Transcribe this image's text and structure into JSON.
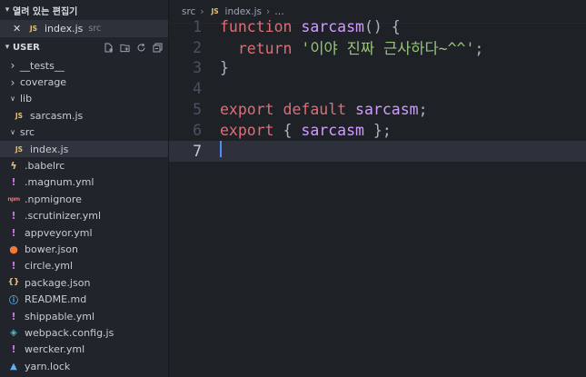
{
  "sidebar": {
    "open_editors_title": "열려 있는 편집기",
    "open_files": [
      {
        "name": "index.js",
        "folder": "src",
        "lang": "JS"
      }
    ],
    "workspace_title": "USER",
    "tree": [
      {
        "label": "__tests__",
        "type": "folder-collapsed",
        "depth": 1
      },
      {
        "label": "coverage",
        "type": "folder-collapsed",
        "depth": 1
      },
      {
        "label": "lib",
        "type": "folder-open",
        "depth": 1
      },
      {
        "label": "sarcasm.js",
        "type": "js",
        "depth": 2
      },
      {
        "label": "src",
        "type": "folder-open",
        "depth": 1
      },
      {
        "label": "index.js",
        "type": "js",
        "depth": 2,
        "selected": true
      },
      {
        "label": ".babelrc",
        "type": "babel",
        "depth": 1
      },
      {
        "label": ".magnum.yml",
        "type": "yml",
        "depth": 1
      },
      {
        "label": ".npmignore",
        "type": "npm",
        "depth": 1
      },
      {
        "label": ".scrutinizer.yml",
        "type": "yml",
        "depth": 1
      },
      {
        "label": "appveyor.yml",
        "type": "yml",
        "depth": 1
      },
      {
        "label": "bower.json",
        "type": "bower",
        "depth": 1
      },
      {
        "label": "circle.yml",
        "type": "yml",
        "depth": 1
      },
      {
        "label": "package.json",
        "type": "json",
        "depth": 1
      },
      {
        "label": "README.md",
        "type": "info",
        "depth": 1
      },
      {
        "label": "shippable.yml",
        "type": "yml",
        "depth": 1
      },
      {
        "label": "webpack.config.js",
        "type": "webpack",
        "depth": 1
      },
      {
        "label": "wercker.yml",
        "type": "yml",
        "depth": 1
      },
      {
        "label": "yarn.lock",
        "type": "yarn",
        "depth": 1
      }
    ]
  },
  "breadcrumb": {
    "folder": "src",
    "file": "index.js",
    "lang": "JS"
  },
  "editor": {
    "current_line": 7,
    "lines": [
      {
        "n": "1",
        "tokens": [
          {
            "t": "function",
            "c": "kw"
          },
          {
            "t": " ",
            "c": "pun"
          },
          {
            "t": "sarcasm",
            "c": "fnname"
          },
          {
            "t": "()",
            "c": "pun"
          },
          {
            "t": " {",
            "c": "pun"
          }
        ]
      },
      {
        "n": "2",
        "tokens": [
          {
            "t": "  return",
            "c": "kw"
          },
          {
            "t": " ",
            "c": "pun"
          },
          {
            "t": "'이야 진짜 근사하다~^^'",
            "c": "str"
          },
          {
            "t": ";",
            "c": "pun"
          }
        ]
      },
      {
        "n": "3",
        "tokens": [
          {
            "t": "}",
            "c": "pun"
          }
        ]
      },
      {
        "n": "4",
        "tokens": []
      },
      {
        "n": "5",
        "tokens": [
          {
            "t": "export",
            "c": "kw"
          },
          {
            "t": " ",
            "c": "pun"
          },
          {
            "t": "default",
            "c": "kw"
          },
          {
            "t": " ",
            "c": "pun"
          },
          {
            "t": "sarcasm",
            "c": "fnname"
          },
          {
            "t": ";",
            "c": "pun"
          }
        ]
      },
      {
        "n": "6",
        "tokens": [
          {
            "t": "export",
            "c": "kw"
          },
          {
            "t": " { ",
            "c": "pun"
          },
          {
            "t": "sarcasm",
            "c": "fnname"
          },
          {
            "t": " };",
            "c": "pun"
          }
        ]
      },
      {
        "n": "7",
        "tokens": []
      }
    ]
  },
  "icons": {
    "close": "close-icon",
    "new_file": "new-file-icon",
    "new_folder": "new-folder-icon",
    "refresh": "refresh-icon",
    "collapse": "collapse-all-icon"
  },
  "colors": {
    "keyword": "#e06c75",
    "function_name": "#d19cff",
    "string": "#98c379",
    "background": "#1e2227",
    "sidebar": "#21252b"
  }
}
